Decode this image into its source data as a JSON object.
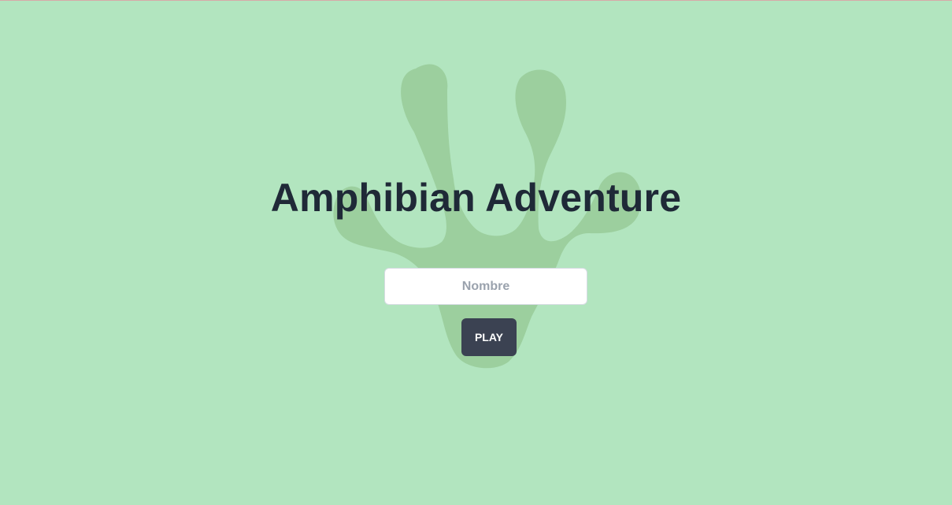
{
  "page": {
    "title": "Amphibian Adventure",
    "name_input": {
      "placeholder": "Nombre",
      "value": ""
    },
    "play_button": {
      "label": "PLAY"
    },
    "background_icon": "frog-foot-icon"
  },
  "colors": {
    "background": "#b2e5bf",
    "frog_foot": "#9ccf9e",
    "title": "#1f2937",
    "button": "#3b4252",
    "button_text": "#ffffff",
    "input_background": "#ffffff",
    "placeholder": "#9aa2ad"
  }
}
